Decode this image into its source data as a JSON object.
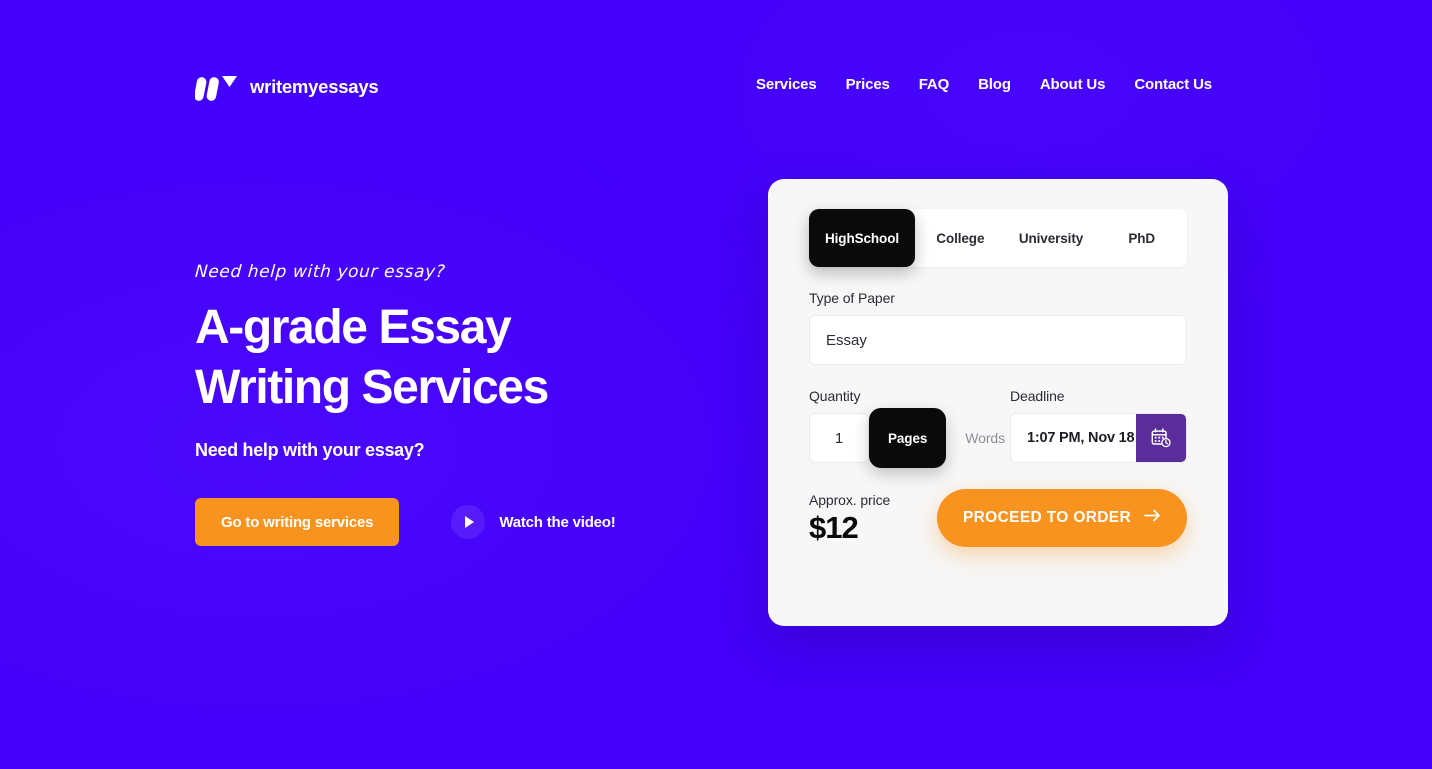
{
  "theme": {
    "background": "#4300FA",
    "accent_orange": "#F7931E",
    "card_background": "#F7F7F7",
    "active_tab": "#0A0A0A",
    "calendar_button": "#5B2D9B"
  },
  "header": {
    "brand_name": "writemyessays",
    "logo_icon": "w-logo-icon",
    "nav": [
      {
        "label": "Services"
      },
      {
        "label": "Prices"
      },
      {
        "label": "FAQ"
      },
      {
        "label": "Blog"
      },
      {
        "label": "About Us"
      },
      {
        "label": "Contact Us"
      }
    ]
  },
  "hero": {
    "eyebrow": "Need help with your essay?",
    "title_line1": "A-grade Essay",
    "title_line2": "Writing Services",
    "subtitle": "Need help with your essay?",
    "primary_cta": "Go to writing services",
    "video_cta": "Watch the video!",
    "play_icon": "play-icon"
  },
  "order_form": {
    "levels": [
      {
        "label": "HighSchool",
        "active": true
      },
      {
        "label": "College",
        "active": false
      },
      {
        "label": "University",
        "active": false
      },
      {
        "label": "PhD",
        "active": false
      }
    ],
    "paper_type": {
      "label": "Type of Paper",
      "value": "Essay",
      "placeholder": "Essay"
    },
    "quantity": {
      "label": "Quantity",
      "value": "1",
      "placeholder": "1",
      "units": [
        {
          "label": "Pages",
          "active": true
        },
        {
          "label": "Words",
          "active": false
        }
      ]
    },
    "deadline": {
      "label": "Deadline",
      "value": "1:07 PM, Nov 18",
      "calendar_icon": "calendar-clock-icon"
    },
    "price": {
      "label": "Approx. price",
      "value": "$12"
    },
    "submit": {
      "label": "PROCEED TO ORDER",
      "arrow_icon": "arrow-right-icon"
    }
  }
}
